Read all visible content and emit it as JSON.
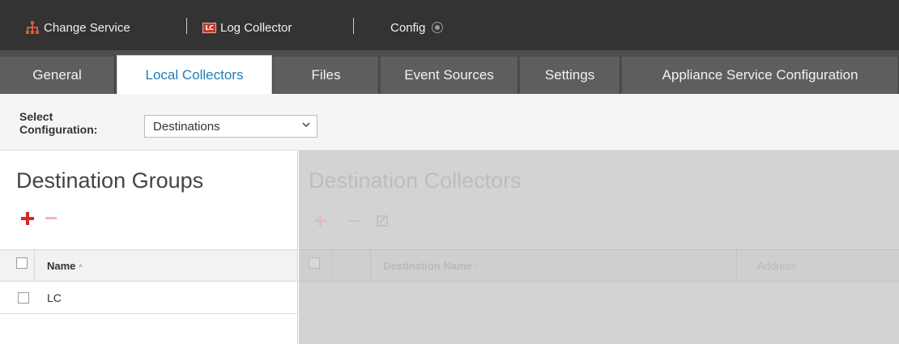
{
  "topbar": {
    "change_service_label": "Change Service",
    "service_icon": "service-tree-icon",
    "log_collector_badge": "LC",
    "log_collector_label": "Log Collector",
    "config_label": "Config",
    "config_dropdown_icon": "dropdown-circle-icon"
  },
  "tabs": [
    {
      "label": "General",
      "active": false
    },
    {
      "label": "Local Collectors",
      "active": true
    },
    {
      "label": "Files",
      "active": false
    },
    {
      "label": "Event Sources",
      "active": false
    },
    {
      "label": "Settings",
      "active": false
    },
    {
      "label": "Appliance Service Configuration",
      "active": false
    }
  ],
  "config": {
    "label_line1": "Select",
    "label_line2": "Configuration:",
    "selected": "Destinations"
  },
  "left_panel": {
    "title": "Destination Groups",
    "add_icon": "plus-icon",
    "remove_icon": "minus-icon",
    "columns": {
      "name": "Name",
      "sort_indicator": "^"
    },
    "rows": [
      {
        "name": "LC",
        "checked": false
      }
    ]
  },
  "right_panel": {
    "title": "Destination Collectors",
    "disabled": true,
    "columns": {
      "destination_name": "Destination Name",
      "sort_indicator": "^",
      "address": "Address"
    }
  },
  "colors": {
    "topbar": "#333333",
    "tab_strip": "#4e4e4e",
    "active_tab_text": "#1f7dba",
    "add_icon": "#d42a2a",
    "disabled_panel": "#d3d3d3"
  }
}
